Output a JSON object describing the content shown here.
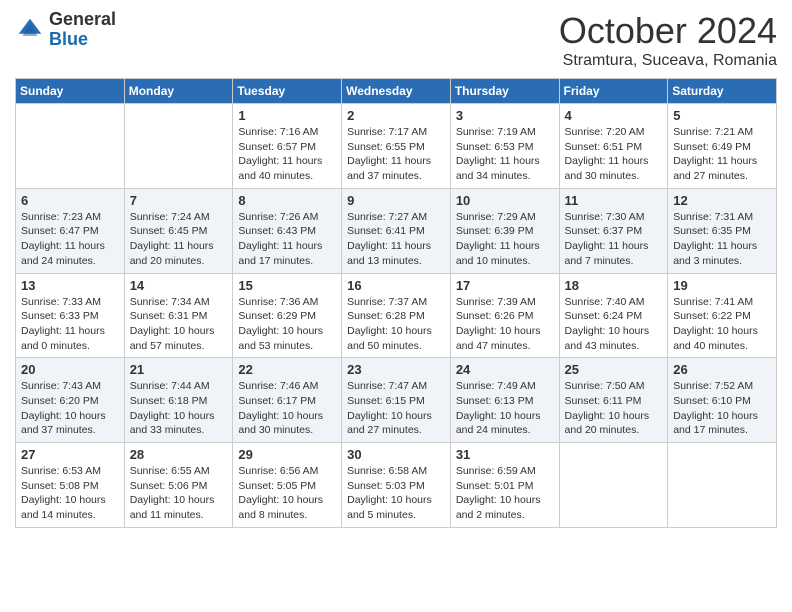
{
  "logo": {
    "general": "General",
    "blue": "Blue"
  },
  "header": {
    "month": "October 2024",
    "location": "Stramtura, Suceava, Romania"
  },
  "weekdays": [
    "Sunday",
    "Monday",
    "Tuesday",
    "Wednesday",
    "Thursday",
    "Friday",
    "Saturday"
  ],
  "weeks": [
    [
      {
        "day": "",
        "sunrise": "",
        "sunset": "",
        "daylight": ""
      },
      {
        "day": "",
        "sunrise": "",
        "sunset": "",
        "daylight": ""
      },
      {
        "day": "1",
        "sunrise": "Sunrise: 7:16 AM",
        "sunset": "Sunset: 6:57 PM",
        "daylight": "Daylight: 11 hours and 40 minutes."
      },
      {
        "day": "2",
        "sunrise": "Sunrise: 7:17 AM",
        "sunset": "Sunset: 6:55 PM",
        "daylight": "Daylight: 11 hours and 37 minutes."
      },
      {
        "day": "3",
        "sunrise": "Sunrise: 7:19 AM",
        "sunset": "Sunset: 6:53 PM",
        "daylight": "Daylight: 11 hours and 34 minutes."
      },
      {
        "day": "4",
        "sunrise": "Sunrise: 7:20 AM",
        "sunset": "Sunset: 6:51 PM",
        "daylight": "Daylight: 11 hours and 30 minutes."
      },
      {
        "day": "5",
        "sunrise": "Sunrise: 7:21 AM",
        "sunset": "Sunset: 6:49 PM",
        "daylight": "Daylight: 11 hours and 27 minutes."
      }
    ],
    [
      {
        "day": "6",
        "sunrise": "Sunrise: 7:23 AM",
        "sunset": "Sunset: 6:47 PM",
        "daylight": "Daylight: 11 hours and 24 minutes."
      },
      {
        "day": "7",
        "sunrise": "Sunrise: 7:24 AM",
        "sunset": "Sunset: 6:45 PM",
        "daylight": "Daylight: 11 hours and 20 minutes."
      },
      {
        "day": "8",
        "sunrise": "Sunrise: 7:26 AM",
        "sunset": "Sunset: 6:43 PM",
        "daylight": "Daylight: 11 hours and 17 minutes."
      },
      {
        "day": "9",
        "sunrise": "Sunrise: 7:27 AM",
        "sunset": "Sunset: 6:41 PM",
        "daylight": "Daylight: 11 hours and 13 minutes."
      },
      {
        "day": "10",
        "sunrise": "Sunrise: 7:29 AM",
        "sunset": "Sunset: 6:39 PM",
        "daylight": "Daylight: 11 hours and 10 minutes."
      },
      {
        "day": "11",
        "sunrise": "Sunrise: 7:30 AM",
        "sunset": "Sunset: 6:37 PM",
        "daylight": "Daylight: 11 hours and 7 minutes."
      },
      {
        "day": "12",
        "sunrise": "Sunrise: 7:31 AM",
        "sunset": "Sunset: 6:35 PM",
        "daylight": "Daylight: 11 hours and 3 minutes."
      }
    ],
    [
      {
        "day": "13",
        "sunrise": "Sunrise: 7:33 AM",
        "sunset": "Sunset: 6:33 PM",
        "daylight": "Daylight: 11 hours and 0 minutes."
      },
      {
        "day": "14",
        "sunrise": "Sunrise: 7:34 AM",
        "sunset": "Sunset: 6:31 PM",
        "daylight": "Daylight: 10 hours and 57 minutes."
      },
      {
        "day": "15",
        "sunrise": "Sunrise: 7:36 AM",
        "sunset": "Sunset: 6:29 PM",
        "daylight": "Daylight: 10 hours and 53 minutes."
      },
      {
        "day": "16",
        "sunrise": "Sunrise: 7:37 AM",
        "sunset": "Sunset: 6:28 PM",
        "daylight": "Daylight: 10 hours and 50 minutes."
      },
      {
        "day": "17",
        "sunrise": "Sunrise: 7:39 AM",
        "sunset": "Sunset: 6:26 PM",
        "daylight": "Daylight: 10 hours and 47 minutes."
      },
      {
        "day": "18",
        "sunrise": "Sunrise: 7:40 AM",
        "sunset": "Sunset: 6:24 PM",
        "daylight": "Daylight: 10 hours and 43 minutes."
      },
      {
        "day": "19",
        "sunrise": "Sunrise: 7:41 AM",
        "sunset": "Sunset: 6:22 PM",
        "daylight": "Daylight: 10 hours and 40 minutes."
      }
    ],
    [
      {
        "day": "20",
        "sunrise": "Sunrise: 7:43 AM",
        "sunset": "Sunset: 6:20 PM",
        "daylight": "Daylight: 10 hours and 37 minutes."
      },
      {
        "day": "21",
        "sunrise": "Sunrise: 7:44 AM",
        "sunset": "Sunset: 6:18 PM",
        "daylight": "Daylight: 10 hours and 33 minutes."
      },
      {
        "day": "22",
        "sunrise": "Sunrise: 7:46 AM",
        "sunset": "Sunset: 6:17 PM",
        "daylight": "Daylight: 10 hours and 30 minutes."
      },
      {
        "day": "23",
        "sunrise": "Sunrise: 7:47 AM",
        "sunset": "Sunset: 6:15 PM",
        "daylight": "Daylight: 10 hours and 27 minutes."
      },
      {
        "day": "24",
        "sunrise": "Sunrise: 7:49 AM",
        "sunset": "Sunset: 6:13 PM",
        "daylight": "Daylight: 10 hours and 24 minutes."
      },
      {
        "day": "25",
        "sunrise": "Sunrise: 7:50 AM",
        "sunset": "Sunset: 6:11 PM",
        "daylight": "Daylight: 10 hours and 20 minutes."
      },
      {
        "day": "26",
        "sunrise": "Sunrise: 7:52 AM",
        "sunset": "Sunset: 6:10 PM",
        "daylight": "Daylight: 10 hours and 17 minutes."
      }
    ],
    [
      {
        "day": "27",
        "sunrise": "Sunrise: 6:53 AM",
        "sunset": "Sunset: 5:08 PM",
        "daylight": "Daylight: 10 hours and 14 minutes."
      },
      {
        "day": "28",
        "sunrise": "Sunrise: 6:55 AM",
        "sunset": "Sunset: 5:06 PM",
        "daylight": "Daylight: 10 hours and 11 minutes."
      },
      {
        "day": "29",
        "sunrise": "Sunrise: 6:56 AM",
        "sunset": "Sunset: 5:05 PM",
        "daylight": "Daylight: 10 hours and 8 minutes."
      },
      {
        "day": "30",
        "sunrise": "Sunrise: 6:58 AM",
        "sunset": "Sunset: 5:03 PM",
        "daylight": "Daylight: 10 hours and 5 minutes."
      },
      {
        "day": "31",
        "sunrise": "Sunrise: 6:59 AM",
        "sunset": "Sunset: 5:01 PM",
        "daylight": "Daylight: 10 hours and 2 minutes."
      },
      {
        "day": "",
        "sunrise": "",
        "sunset": "",
        "daylight": ""
      },
      {
        "day": "",
        "sunrise": "",
        "sunset": "",
        "daylight": ""
      }
    ]
  ]
}
